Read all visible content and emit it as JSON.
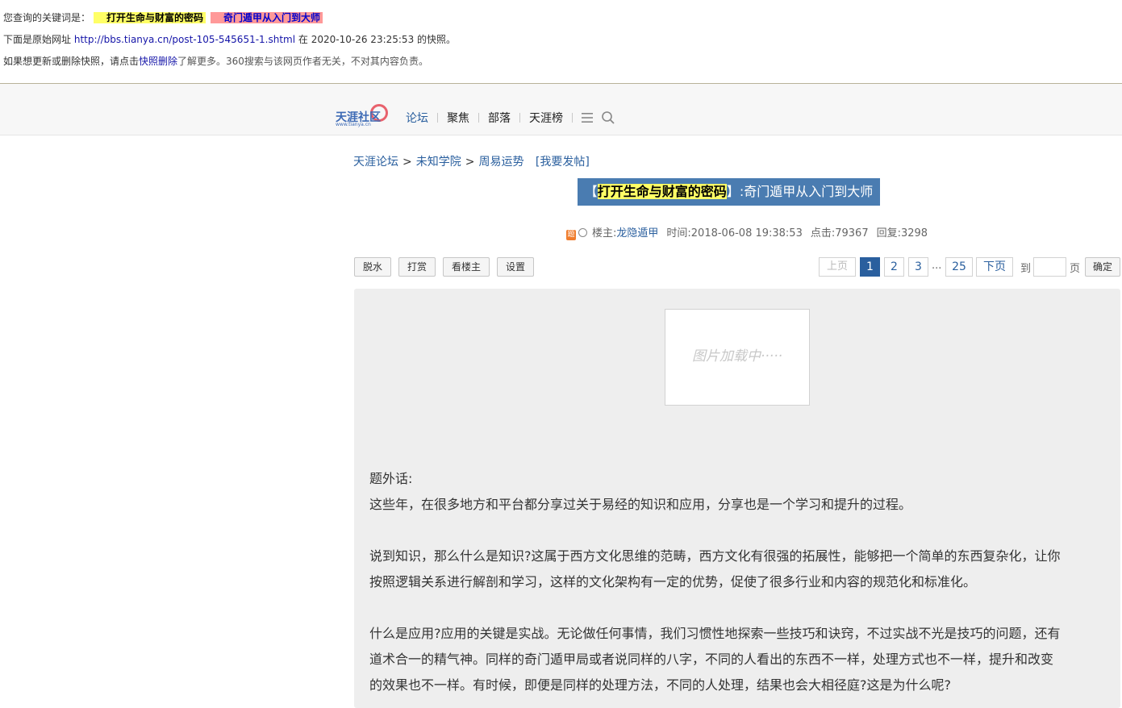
{
  "snapshot": {
    "query_label": "您查询的关键词是：",
    "keyword1": "打开生命与财富的密码",
    "keyword2": "奇门遁甲从入门到大师",
    "origin_prefix": "下面是原始网址",
    "origin_url": "http://bbs.tianya.cn/post-105-545651-1.shtml",
    "origin_mid": "在",
    "origin_time": "2020-10-26 23:25:53",
    "origin_suffix": "的快照。",
    "notice_prefix": "如果想更新或删除快照，请点击",
    "notice_link": "快照删除",
    "notice_suffix": "了解更多。360搜索与该网页作者无关，不对其内容负责。"
  },
  "header": {
    "logo_text": "天涯社区",
    "logo_url": "www.tianya.cn",
    "nav": [
      "论坛",
      "聚焦",
      "部落",
      "天涯榜"
    ],
    "icons": [
      "menu-icon",
      "search-icon"
    ]
  },
  "breadcrumb": {
    "items": [
      "天涯论坛",
      "未知学院",
      "周易运势"
    ],
    "sep": ">",
    "post_link": "[我要发帖]"
  },
  "post": {
    "title_bracket_open": "【",
    "title_highlight": "打开生命与财富的密码",
    "title_bracket_close": "】",
    "title_rest": ":奇门遁甲从入门到大师",
    "badge": "题",
    "author_label": "楼主:",
    "author": "龙隐遁甲",
    "time": "时间:2018-06-08 19:38:53",
    "clicks": "点击:79367",
    "replies": "回复:3298"
  },
  "toolbar": {
    "buttons": [
      "脱水",
      "打赏",
      "看楼主",
      "设置"
    ]
  },
  "pager": {
    "prev": "上页",
    "pages": [
      "1",
      "2",
      "3"
    ],
    "ellipsis": "...",
    "last": "25",
    "next": "下页",
    "goto_label": "到",
    "page_label": "页",
    "confirm": "确定",
    "current": 1
  },
  "content": {
    "image_placeholder": "图片加载中·····",
    "lines": [
      "题外话:",
      "这些年，在很多地方和平台都分享过关于易经的知识和应用，分享也是一个学习和提升的过程。",
      "说到知识，那么什么是知识?这属于西方文化思维的范畴，西方文化有很强的拓展性，能够把一个简单的东西复杂化，让你",
      "按照逻辑关系进行解剖和学习，这样的文化架构有一定的优势，促使了很多行业和内容的规范化和标准化。",
      "什么是应用?应用的关键是实战。无论做任何事情，我们习惯性地探索一些技巧和诀窍，不过实战不光是技巧的问题，还有",
      "道术合一的精气神。同样的奇门遁甲局或者说同样的八字，不同的人看出的东西不一样，处理方式也不一样，提升和改变",
      "的效果也不一样。有时候，即便是同样的处理方法，不同的人处理，结果也会大相径庭?这是为什么呢?"
    ]
  }
}
